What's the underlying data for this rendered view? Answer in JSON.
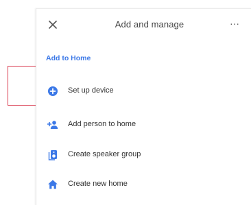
{
  "header": {
    "close_icon": "close-icon",
    "title": "Add and manage",
    "more_icon": "more-horizontal-icon",
    "more_glyph": "···"
  },
  "section": {
    "title": "Add to Home"
  },
  "items": [
    {
      "label": "Set up device",
      "icon": "add-circle-icon"
    },
    {
      "label": "Add person to home",
      "icon": "add-person-icon"
    },
    {
      "label": "Create speaker group",
      "icon": "speaker-group-icon"
    },
    {
      "label": "Create new home",
      "icon": "home-icon"
    }
  ],
  "colors": {
    "accent": "#3b78e7",
    "highlight": "#d9384c",
    "text": "#333333"
  }
}
